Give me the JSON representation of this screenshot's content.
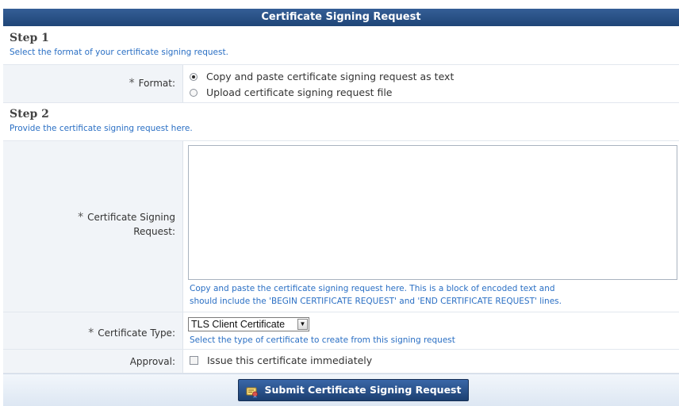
{
  "header": {
    "title": "Certificate Signing Request"
  },
  "step1": {
    "title": "Step 1",
    "description": "Select the format of your certificate signing request.",
    "format": {
      "label": "Format:",
      "required_mark": "*",
      "options": [
        {
          "label": "Copy and paste certificate signing request as text",
          "selected": true
        },
        {
          "label": "Upload certificate signing request file",
          "selected": false
        }
      ]
    }
  },
  "step2": {
    "title": "Step 2",
    "description": "Provide the certificate signing request here.",
    "csr": {
      "label_line1": "Certificate Signing",
      "label_line2": "Request:",
      "required_mark": "*",
      "value": "",
      "help_line1": "Copy and paste the certificate signing request here. This is a block of encoded text and",
      "help_line2": "should include the 'BEGIN CERTIFICATE REQUEST' and 'END CERTIFICATE REQUEST' lines."
    },
    "cert_type": {
      "label": "Certificate Type:",
      "required_mark": "*",
      "selected": "TLS Client Certificate",
      "help": "Select the type of certificate to create from this signing request"
    },
    "approval": {
      "label": "Approval:",
      "checkbox_label": "Issue this certificate immediately",
      "checked": false
    }
  },
  "footer": {
    "submit_label": "Submit Certificate Signing Request"
  },
  "colors": {
    "header": "#1f4577",
    "link": "#2a6fc4",
    "label_bg": "#f1f4f8"
  }
}
